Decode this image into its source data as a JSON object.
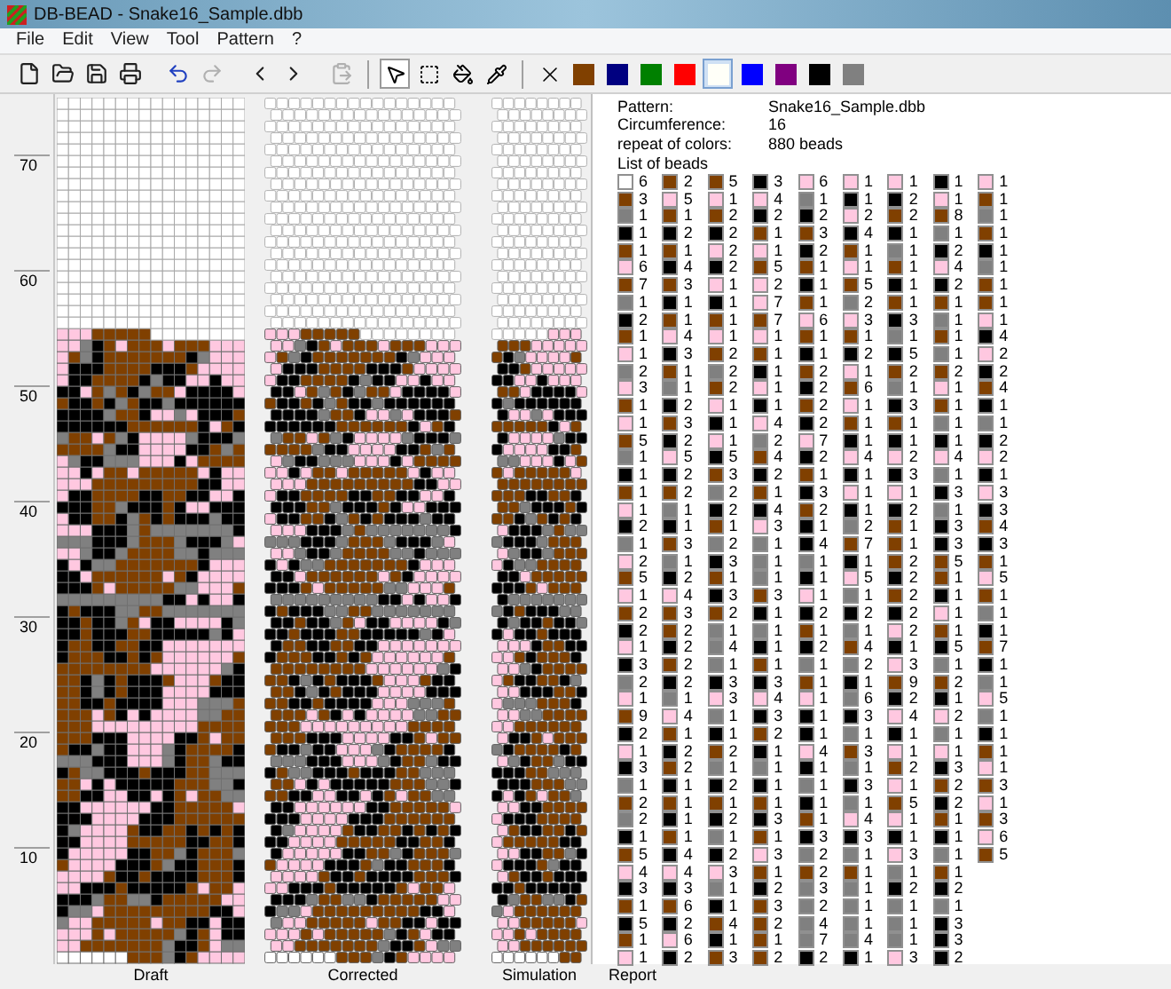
{
  "window": {
    "title": "DB-BEAD - Snake16_Sample.dbb"
  },
  "menu": [
    "File",
    "Edit",
    "View",
    "Tool",
    "Pattern",
    "?"
  ],
  "toolbar": [
    {
      "kind": "new",
      "disabled": false
    },
    {
      "kind": "open",
      "disabled": false
    },
    {
      "kind": "save",
      "disabled": false
    },
    {
      "kind": "print",
      "disabled": false
    },
    {
      "kind": "undo",
      "disabled": false
    },
    {
      "kind": "redo",
      "disabled": true
    },
    {
      "kind": "prev",
      "disabled": false
    },
    {
      "kind": "next",
      "disabled": false
    },
    {
      "kind": "paste",
      "disabled": true
    }
  ],
  "tools": [
    {
      "kind": "pointer",
      "selected": true
    },
    {
      "kind": "select",
      "selected": false
    },
    {
      "kind": "fill",
      "selected": false
    },
    {
      "kind": "picker",
      "selected": false
    }
  ],
  "palette": [
    {
      "color": "#804000",
      "selected": false
    },
    {
      "color": "#000080",
      "selected": false
    },
    {
      "color": "#008000",
      "selected": false
    },
    {
      "color": "#ff0000",
      "selected": false
    },
    {
      "color": "#fffff8",
      "selected": true
    },
    {
      "color": "#0000ff",
      "selected": false
    },
    {
      "color": "#800080",
      "selected": false
    },
    {
      "color": "#000000",
      "selected": false
    },
    {
      "color": "#808080",
      "selected": false
    }
  ],
  "ruler_labels": [
    "70",
    "60",
    "50",
    "40",
    "30",
    "20",
    "10"
  ],
  "views": [
    "Draft",
    "Corrected",
    "Simulation",
    "Report"
  ],
  "report": {
    "info": [
      {
        "label": "Pattern:",
        "value": "Snake16_Sample.dbb"
      },
      {
        "label": "Circumference:",
        "value": "16"
      },
      {
        "label": "repeat of colors:",
        "value": "880 beads"
      }
    ],
    "list_title": "List of beads",
    "columns": [
      [
        {
          "color": "#ffffff",
          "count": "6"
        },
        {
          "color": "#804000",
          "count": "3"
        },
        {
          "color": "#808080",
          "count": "1"
        },
        {
          "color": "#000000",
          "count": "1"
        },
        {
          "color": "#804000",
          "count": "1"
        },
        {
          "color": "#ffc8e0",
          "count": "6"
        },
        {
          "color": "#804000",
          "count": "7"
        },
        {
          "color": "#808080",
          "count": "1"
        },
        {
          "color": "#000000",
          "count": "2"
        },
        {
          "color": "#804000",
          "count": "1"
        },
        {
          "color": "#ffc8e0",
          "count": "1"
        },
        {
          "color": "#808080",
          "count": "2"
        },
        {
          "color": "#ffc8e0",
          "count": "3"
        },
        {
          "color": "#804000",
          "count": "1"
        },
        {
          "color": "#ffc8e0",
          "count": "1"
        },
        {
          "color": "#804000",
          "count": "5"
        },
        {
          "color": "#808080",
          "count": "1"
        },
        {
          "color": "#000000",
          "count": "1"
        },
        {
          "color": "#804000",
          "count": "1"
        },
        {
          "color": "#ffc8e0",
          "count": "1"
        },
        {
          "color": "#000000",
          "count": "2"
        },
        {
          "color": "#808080",
          "count": "1"
        },
        {
          "color": "#ffc8e0",
          "count": "2"
        },
        {
          "color": "#804000",
          "count": "5"
        },
        {
          "color": "#ffc8e0",
          "count": "1"
        },
        {
          "color": "#804000",
          "count": "2"
        },
        {
          "color": "#000000",
          "count": "2"
        },
        {
          "color": "#ffc8e0",
          "count": "1"
        },
        {
          "color": "#000000",
          "count": "3"
        },
        {
          "color": "#808080",
          "count": "2"
        },
        {
          "color": "#ffc8e0",
          "count": "1"
        },
        {
          "color": "#804000",
          "count": "9"
        },
        {
          "color": "#000000",
          "count": "2"
        },
        {
          "color": "#ffc8e0",
          "count": "1"
        },
        {
          "color": "#000000",
          "count": "3"
        },
        {
          "color": "#808080",
          "count": "1"
        },
        {
          "color": "#804000",
          "count": "2"
        },
        {
          "color": "#808080",
          "count": "2"
        },
        {
          "color": "#000000",
          "count": "1"
        },
        {
          "color": "#804000",
          "count": "5"
        },
        {
          "color": "#ffc8e0",
          "count": "4"
        },
        {
          "color": "#000000",
          "count": "3"
        },
        {
          "color": "#804000",
          "count": "1"
        },
        {
          "color": "#000000",
          "count": "5"
        },
        {
          "color": "#804000",
          "count": "1"
        },
        {
          "color": "#ffc8e0",
          "count": "1"
        }
      ],
      [
        {
          "color": "#804000",
          "count": "2"
        },
        {
          "color": "#ffc8e0",
          "count": "5"
        },
        {
          "color": "#804000",
          "count": "1"
        },
        {
          "color": "#000000",
          "count": "2"
        },
        {
          "color": "#804000",
          "count": "1"
        },
        {
          "color": "#000000",
          "count": "4"
        },
        {
          "color": "#804000",
          "count": "3"
        },
        {
          "color": "#000000",
          "count": "1"
        },
        {
          "color": "#804000",
          "count": "1"
        },
        {
          "color": "#ffc8e0",
          "count": "4"
        },
        {
          "color": "#000000",
          "count": "3"
        },
        {
          "color": "#804000",
          "count": "1"
        },
        {
          "color": "#808080",
          "count": "1"
        },
        {
          "color": "#000000",
          "count": "2"
        },
        {
          "color": "#804000",
          "count": "3"
        },
        {
          "color": "#000000",
          "count": "2"
        },
        {
          "color": "#ffc8e0",
          "count": "5"
        },
        {
          "color": "#000000",
          "count": "2"
        },
        {
          "color": "#804000",
          "count": "2"
        },
        {
          "color": "#808080",
          "count": "1"
        },
        {
          "color": "#000000",
          "count": "1"
        },
        {
          "color": "#804000",
          "count": "3"
        },
        {
          "color": "#808080",
          "count": "1"
        },
        {
          "color": "#000000",
          "count": "2"
        },
        {
          "color": "#ffc8e0",
          "count": "4"
        },
        {
          "color": "#804000",
          "count": "3"
        },
        {
          "color": "#804000",
          "count": "2"
        },
        {
          "color": "#000000",
          "count": "2"
        },
        {
          "color": "#804000",
          "count": "2"
        },
        {
          "color": "#000000",
          "count": "2"
        },
        {
          "color": "#808080",
          "count": "1"
        },
        {
          "color": "#ffc8e0",
          "count": "4"
        },
        {
          "color": "#804000",
          "count": "1"
        },
        {
          "color": "#000000",
          "count": "2"
        },
        {
          "color": "#804000",
          "count": "2"
        },
        {
          "color": "#000000",
          "count": "1"
        },
        {
          "color": "#804000",
          "count": "1"
        },
        {
          "color": "#000000",
          "count": "1"
        },
        {
          "color": "#804000",
          "count": "1"
        },
        {
          "color": "#000000",
          "count": "4"
        },
        {
          "color": "#ffc8e0",
          "count": "4"
        },
        {
          "color": "#000000",
          "count": "3"
        },
        {
          "color": "#804000",
          "count": "6"
        },
        {
          "color": "#000000",
          "count": "2"
        },
        {
          "color": "#ffc8e0",
          "count": "6"
        },
        {
          "color": "#000000",
          "count": "2"
        }
      ],
      [
        {
          "color": "#804000",
          "count": "5"
        },
        {
          "color": "#ffc8e0",
          "count": "1"
        },
        {
          "color": "#804000",
          "count": "2"
        },
        {
          "color": "#000000",
          "count": "2"
        },
        {
          "color": "#ffc8e0",
          "count": "2"
        },
        {
          "color": "#000000",
          "count": "2"
        },
        {
          "color": "#ffc8e0",
          "count": "1"
        },
        {
          "color": "#000000",
          "count": "1"
        },
        {
          "color": "#804000",
          "count": "1"
        },
        {
          "color": "#ffc8e0",
          "count": "1"
        },
        {
          "color": "#804000",
          "count": "2"
        },
        {
          "color": "#808080",
          "count": "2"
        },
        {
          "color": "#804000",
          "count": "2"
        },
        {
          "color": "#ffc8e0",
          "count": "1"
        },
        {
          "color": "#000000",
          "count": "1"
        },
        {
          "color": "#ffc8e0",
          "count": "1"
        },
        {
          "color": "#000000",
          "count": "5"
        },
        {
          "color": "#804000",
          "count": "3"
        },
        {
          "color": "#808080",
          "count": "2"
        },
        {
          "color": "#000000",
          "count": "2"
        },
        {
          "color": "#804000",
          "count": "1"
        },
        {
          "color": "#808080",
          "count": "2"
        },
        {
          "color": "#000000",
          "count": "3"
        },
        {
          "color": "#804000",
          "count": "1"
        },
        {
          "color": "#000000",
          "count": "3"
        },
        {
          "color": "#804000",
          "count": "2"
        },
        {
          "color": "#808080",
          "count": "1"
        },
        {
          "color": "#808080",
          "count": "4"
        },
        {
          "color": "#808080",
          "count": "1"
        },
        {
          "color": "#000000",
          "count": "3"
        },
        {
          "color": "#ffc8e0",
          "count": "3"
        },
        {
          "color": "#808080",
          "count": "1"
        },
        {
          "color": "#000000",
          "count": "1"
        },
        {
          "color": "#804000",
          "count": "2"
        },
        {
          "color": "#808080",
          "count": "1"
        },
        {
          "color": "#000000",
          "count": "2"
        },
        {
          "color": "#804000",
          "count": "1"
        },
        {
          "color": "#000000",
          "count": "2"
        },
        {
          "color": "#808080",
          "count": "1"
        },
        {
          "color": "#000000",
          "count": "2"
        },
        {
          "color": "#ffc8e0",
          "count": "3"
        },
        {
          "color": "#808080",
          "count": "1"
        },
        {
          "color": "#000000",
          "count": "1"
        },
        {
          "color": "#804000",
          "count": "4"
        },
        {
          "color": "#000000",
          "count": "1"
        },
        {
          "color": "#804000",
          "count": "3"
        }
      ],
      [
        {
          "color": "#000000",
          "count": "3"
        },
        {
          "color": "#ffc8e0",
          "count": "4"
        },
        {
          "color": "#000000",
          "count": "2"
        },
        {
          "color": "#804000",
          "count": "1"
        },
        {
          "color": "#ffc8e0",
          "count": "1"
        },
        {
          "color": "#804000",
          "count": "5"
        },
        {
          "color": "#ffc8e0",
          "count": "2"
        },
        {
          "color": "#ffc8e0",
          "count": "7"
        },
        {
          "color": "#804000",
          "count": "7"
        },
        {
          "color": "#ffc8e0",
          "count": "1"
        },
        {
          "color": "#804000",
          "count": "1"
        },
        {
          "color": "#000000",
          "count": "1"
        },
        {
          "color": "#ffc8e0",
          "count": "1"
        },
        {
          "color": "#000000",
          "count": "1"
        },
        {
          "color": "#ffc8e0",
          "count": "4"
        },
        {
          "color": "#808080",
          "count": "2"
        },
        {
          "color": "#804000",
          "count": "4"
        },
        {
          "color": "#000000",
          "count": "2"
        },
        {
          "color": "#804000",
          "count": "1"
        },
        {
          "color": "#000000",
          "count": "4"
        },
        {
          "color": "#ffc8e0",
          "count": "3"
        },
        {
          "color": "#808080",
          "count": "1"
        },
        {
          "color": "#808080",
          "count": "1"
        },
        {
          "color": "#808080",
          "count": "1"
        },
        {
          "color": "#804000",
          "count": "3"
        },
        {
          "color": "#000000",
          "count": "1"
        },
        {
          "color": "#808080",
          "count": "1"
        },
        {
          "color": "#000000",
          "count": "1"
        },
        {
          "color": "#804000",
          "count": "1"
        },
        {
          "color": "#000000",
          "count": "3"
        },
        {
          "color": "#ffc8e0",
          "count": "4"
        },
        {
          "color": "#000000",
          "count": "3"
        },
        {
          "color": "#804000",
          "count": "2"
        },
        {
          "color": "#000000",
          "count": "1"
        },
        {
          "color": "#808080",
          "count": "1"
        },
        {
          "color": "#000000",
          "count": "1"
        },
        {
          "color": "#804000",
          "count": "1"
        },
        {
          "color": "#000000",
          "count": "3"
        },
        {
          "color": "#804000",
          "count": "1"
        },
        {
          "color": "#ffc8e0",
          "count": "3"
        },
        {
          "color": "#804000",
          "count": "1"
        },
        {
          "color": "#000000",
          "count": "2"
        },
        {
          "color": "#804000",
          "count": "3"
        },
        {
          "color": "#804000",
          "count": "2"
        },
        {
          "color": "#804000",
          "count": "1"
        },
        {
          "color": "#804000",
          "count": "2"
        }
      ],
      [
        {
          "color": "#ffc8e0",
          "count": "6"
        },
        {
          "color": "#808080",
          "count": "1"
        },
        {
          "color": "#000000",
          "count": "2"
        },
        {
          "color": "#804000",
          "count": "3"
        },
        {
          "color": "#000000",
          "count": "2"
        },
        {
          "color": "#804000",
          "count": "1"
        },
        {
          "color": "#000000",
          "count": "1"
        },
        {
          "color": "#804000",
          "count": "1"
        },
        {
          "color": "#ffc8e0",
          "count": "6"
        },
        {
          "color": "#804000",
          "count": "1"
        },
        {
          "color": "#000000",
          "count": "1"
        },
        {
          "color": "#804000",
          "count": "2"
        },
        {
          "color": "#000000",
          "count": "2"
        },
        {
          "color": "#804000",
          "count": "2"
        },
        {
          "color": "#000000",
          "count": "2"
        },
        {
          "color": "#ffc8e0",
          "count": "7"
        },
        {
          "color": "#000000",
          "count": "2"
        },
        {
          "color": "#804000",
          "count": "1"
        },
        {
          "color": "#000000",
          "count": "3"
        },
        {
          "color": "#804000",
          "count": "2"
        },
        {
          "color": "#000000",
          "count": "1"
        },
        {
          "color": "#000000",
          "count": "4"
        },
        {
          "color": "#808080",
          "count": "1"
        },
        {
          "color": "#000000",
          "count": "1"
        },
        {
          "color": "#ffc8e0",
          "count": "1"
        },
        {
          "color": "#000000",
          "count": "2"
        },
        {
          "color": "#804000",
          "count": "1"
        },
        {
          "color": "#000000",
          "count": "2"
        },
        {
          "color": "#808080",
          "count": "1"
        },
        {
          "color": "#804000",
          "count": "1"
        },
        {
          "color": "#ffc8e0",
          "count": "1"
        },
        {
          "color": "#000000",
          "count": "1"
        },
        {
          "color": "#000000",
          "count": "1"
        },
        {
          "color": "#ffc8e0",
          "count": "4"
        },
        {
          "color": "#000000",
          "count": "1"
        },
        {
          "color": "#808080",
          "count": "1"
        },
        {
          "color": "#000000",
          "count": "1"
        },
        {
          "color": "#804000",
          "count": "1"
        },
        {
          "color": "#000000",
          "count": "3"
        },
        {
          "color": "#808080",
          "count": "2"
        },
        {
          "color": "#804000",
          "count": "2"
        },
        {
          "color": "#808080",
          "count": "3"
        },
        {
          "color": "#808080",
          "count": "2"
        },
        {
          "color": "#808080",
          "count": "4"
        },
        {
          "color": "#808080",
          "count": "7"
        },
        {
          "color": "#000000",
          "count": "2"
        }
      ],
      [
        {
          "color": "#ffc8e0",
          "count": "1"
        },
        {
          "color": "#000000",
          "count": "1"
        },
        {
          "color": "#ffc8e0",
          "count": "2"
        },
        {
          "color": "#000000",
          "count": "4"
        },
        {
          "color": "#804000",
          "count": "1"
        },
        {
          "color": "#ffc8e0",
          "count": "1"
        },
        {
          "color": "#804000",
          "count": "5"
        },
        {
          "color": "#808080",
          "count": "2"
        },
        {
          "color": "#ffc8e0",
          "count": "3"
        },
        {
          "color": "#804000",
          "count": "1"
        },
        {
          "color": "#000000",
          "count": "2"
        },
        {
          "color": "#ffc8e0",
          "count": "1"
        },
        {
          "color": "#804000",
          "count": "6"
        },
        {
          "color": "#ffc8e0",
          "count": "1"
        },
        {
          "color": "#804000",
          "count": "1"
        },
        {
          "color": "#000000",
          "count": "1"
        },
        {
          "color": "#ffc8e0",
          "count": "4"
        },
        {
          "color": "#000000",
          "count": "1"
        },
        {
          "color": "#ffc8e0",
          "count": "1"
        },
        {
          "color": "#000000",
          "count": "1"
        },
        {
          "color": "#808080",
          "count": "2"
        },
        {
          "color": "#804000",
          "count": "7"
        },
        {
          "color": "#000000",
          "count": "1"
        },
        {
          "color": "#ffc8e0",
          "count": "5"
        },
        {
          "color": "#808080",
          "count": "1"
        },
        {
          "color": "#000000",
          "count": "2"
        },
        {
          "color": "#808080",
          "count": "1"
        },
        {
          "color": "#804000",
          "count": "4"
        },
        {
          "color": "#808080",
          "count": "2"
        },
        {
          "color": "#000000",
          "count": "1"
        },
        {
          "color": "#808080",
          "count": "6"
        },
        {
          "color": "#000000",
          "count": "3"
        },
        {
          "color": "#808080",
          "count": "1"
        },
        {
          "color": "#804000",
          "count": "3"
        },
        {
          "color": "#808080",
          "count": "1"
        },
        {
          "color": "#000000",
          "count": "3"
        },
        {
          "color": "#808080",
          "count": "1"
        },
        {
          "color": "#ffc8e0",
          "count": "4"
        },
        {
          "color": "#000000",
          "count": "3"
        },
        {
          "color": "#808080",
          "count": "1"
        },
        {
          "color": "#804000",
          "count": "1"
        },
        {
          "color": "#808080",
          "count": "1"
        },
        {
          "color": "#808080",
          "count": "1"
        },
        {
          "color": "#808080",
          "count": "1"
        },
        {
          "color": "#808080",
          "count": "4"
        },
        {
          "color": "#000000",
          "count": "1"
        }
      ],
      [
        {
          "color": "#ffc8e0",
          "count": "1"
        },
        {
          "color": "#000000",
          "count": "2"
        },
        {
          "color": "#804000",
          "count": "2"
        },
        {
          "color": "#000000",
          "count": "1"
        },
        {
          "color": "#808080",
          "count": "1"
        },
        {
          "color": "#804000",
          "count": "1"
        },
        {
          "color": "#000000",
          "count": "1"
        },
        {
          "color": "#804000",
          "count": "1"
        },
        {
          "color": "#000000",
          "count": "3"
        },
        {
          "color": "#808080",
          "count": "1"
        },
        {
          "color": "#000000",
          "count": "5"
        },
        {
          "color": "#804000",
          "count": "2"
        },
        {
          "color": "#808080",
          "count": "1"
        },
        {
          "color": "#000000",
          "count": "3"
        },
        {
          "color": "#804000",
          "count": "1"
        },
        {
          "color": "#000000",
          "count": "1"
        },
        {
          "color": "#ffc8e0",
          "count": "2"
        },
        {
          "color": "#000000",
          "count": "3"
        },
        {
          "color": "#ffc8e0",
          "count": "1"
        },
        {
          "color": "#000000",
          "count": "2"
        },
        {
          "color": "#804000",
          "count": "1"
        },
        {
          "color": "#804000",
          "count": "1"
        },
        {
          "color": "#804000",
          "count": "2"
        },
        {
          "color": "#000000",
          "count": "2"
        },
        {
          "color": "#804000",
          "count": "2"
        },
        {
          "color": "#000000",
          "count": "2"
        },
        {
          "color": "#ffc8e0",
          "count": "2"
        },
        {
          "color": "#000000",
          "count": "1"
        },
        {
          "color": "#ffc8e0",
          "count": "3"
        },
        {
          "color": "#804000",
          "count": "9"
        },
        {
          "color": "#000000",
          "count": "2"
        },
        {
          "color": "#ffc8e0",
          "count": "4"
        },
        {
          "color": "#000000",
          "count": "1"
        },
        {
          "color": "#ffc8e0",
          "count": "1"
        },
        {
          "color": "#804000",
          "count": "2"
        },
        {
          "color": "#ffc8e0",
          "count": "1"
        },
        {
          "color": "#804000",
          "count": "5"
        },
        {
          "color": "#ffc8e0",
          "count": "1"
        },
        {
          "color": "#000000",
          "count": "1"
        },
        {
          "color": "#ffc8e0",
          "count": "3"
        },
        {
          "color": "#808080",
          "count": "1"
        },
        {
          "color": "#000000",
          "count": "2"
        },
        {
          "color": "#808080",
          "count": "1"
        },
        {
          "color": "#808080",
          "count": "1"
        },
        {
          "color": "#808080",
          "count": "1"
        },
        {
          "color": "#ffc8e0",
          "count": "3"
        }
      ],
      [
        {
          "color": "#000000",
          "count": "1"
        },
        {
          "color": "#ffc8e0",
          "count": "1"
        },
        {
          "color": "#804000",
          "count": "8"
        },
        {
          "color": "#808080",
          "count": "1"
        },
        {
          "color": "#000000",
          "count": "2"
        },
        {
          "color": "#ffc8e0",
          "count": "4"
        },
        {
          "color": "#000000",
          "count": "2"
        },
        {
          "color": "#804000",
          "count": "1"
        },
        {
          "color": "#808080",
          "count": "1"
        },
        {
          "color": "#804000",
          "count": "1"
        },
        {
          "color": "#808080",
          "count": "1"
        },
        {
          "color": "#804000",
          "count": "2"
        },
        {
          "color": "#ffc8e0",
          "count": "1"
        },
        {
          "color": "#804000",
          "count": "1"
        },
        {
          "color": "#808080",
          "count": "1"
        },
        {
          "color": "#000000",
          "count": "1"
        },
        {
          "color": "#ffc8e0",
          "count": "4"
        },
        {
          "color": "#808080",
          "count": "1"
        },
        {
          "color": "#000000",
          "count": "3"
        },
        {
          "color": "#808080",
          "count": "1"
        },
        {
          "color": "#000000",
          "count": "3"
        },
        {
          "color": "#000000",
          "count": "3"
        },
        {
          "color": "#804000",
          "count": "5"
        },
        {
          "color": "#804000",
          "count": "1"
        },
        {
          "color": "#000000",
          "count": "1"
        },
        {
          "color": "#ffc8e0",
          "count": "1"
        },
        {
          "color": "#804000",
          "count": "1"
        },
        {
          "color": "#000000",
          "count": "5"
        },
        {
          "color": "#808080",
          "count": "1"
        },
        {
          "color": "#804000",
          "count": "2"
        },
        {
          "color": "#000000",
          "count": "1"
        },
        {
          "color": "#ffc8e0",
          "count": "2"
        },
        {
          "color": "#808080",
          "count": "1"
        },
        {
          "color": "#ffc8e0",
          "count": "1"
        },
        {
          "color": "#000000",
          "count": "3"
        },
        {
          "color": "#804000",
          "count": "2"
        },
        {
          "color": "#000000",
          "count": "2"
        },
        {
          "color": "#804000",
          "count": "1"
        },
        {
          "color": "#000000",
          "count": "1"
        },
        {
          "color": "#808080",
          "count": "1"
        },
        {
          "color": "#804000",
          "count": "1"
        },
        {
          "color": "#000000",
          "count": "2"
        },
        {
          "color": "#808080",
          "count": "1"
        },
        {
          "color": "#000000",
          "count": "3"
        },
        {
          "color": "#000000",
          "count": "3"
        },
        {
          "color": "#000000",
          "count": "2"
        }
      ],
      [
        {
          "color": "#ffc8e0",
          "count": "1"
        },
        {
          "color": "#804000",
          "count": "1"
        },
        {
          "color": "#808080",
          "count": "1"
        },
        {
          "color": "#804000",
          "count": "1"
        },
        {
          "color": "#000000",
          "count": "1"
        },
        {
          "color": "#808080",
          "count": "1"
        },
        {
          "color": "#804000",
          "count": "1"
        },
        {
          "color": "#804000",
          "count": "1"
        },
        {
          "color": "#ffc8e0",
          "count": "1"
        },
        {
          "color": "#000000",
          "count": "4"
        },
        {
          "color": "#ffc8e0",
          "count": "2"
        },
        {
          "color": "#000000",
          "count": "2"
        },
        {
          "color": "#804000",
          "count": "4"
        },
        {
          "color": "#000000",
          "count": "1"
        },
        {
          "color": "#808080",
          "count": "1"
        },
        {
          "color": "#000000",
          "count": "2"
        },
        {
          "color": "#ffc8e0",
          "count": "2"
        },
        {
          "color": "#000000",
          "count": "1"
        },
        {
          "color": "#ffc8e0",
          "count": "3"
        },
        {
          "color": "#000000",
          "count": "3"
        },
        {
          "color": "#804000",
          "count": "4"
        },
        {
          "color": "#000000",
          "count": "3"
        },
        {
          "color": "#804000",
          "count": "1"
        },
        {
          "color": "#ffc8e0",
          "count": "5"
        },
        {
          "color": "#804000",
          "count": "1"
        },
        {
          "color": "#808080",
          "count": "1"
        },
        {
          "color": "#000000",
          "count": "1"
        },
        {
          "color": "#804000",
          "count": "7"
        },
        {
          "color": "#000000",
          "count": "1"
        },
        {
          "color": "#808080",
          "count": "1"
        },
        {
          "color": "#ffc8e0",
          "count": "5"
        },
        {
          "color": "#808080",
          "count": "1"
        },
        {
          "color": "#000000",
          "count": "1"
        },
        {
          "color": "#804000",
          "count": "1"
        },
        {
          "color": "#ffc8e0",
          "count": "1"
        },
        {
          "color": "#804000",
          "count": "3"
        },
        {
          "color": "#ffc8e0",
          "count": "1"
        },
        {
          "color": "#804000",
          "count": "3"
        },
        {
          "color": "#ffc8e0",
          "count": "6"
        },
        {
          "color": "#804000",
          "count": "5"
        }
      ]
    ]
  }
}
